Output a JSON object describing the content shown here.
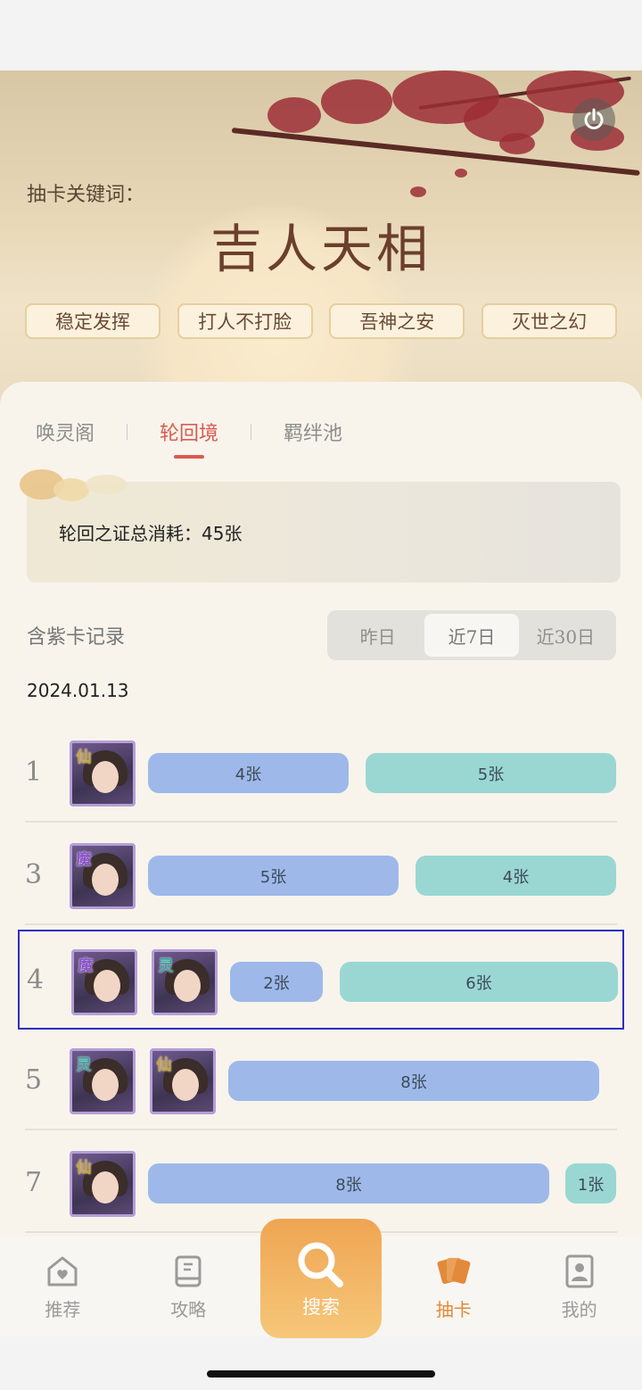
{
  "hero": {
    "keyword_label": "抽卡关键词：",
    "keyword_title": "吉人天相",
    "tags": [
      "稳定发挥",
      "打人不打脸",
      "吾神之安",
      "灭世之幻"
    ],
    "power_icon": "power-icon"
  },
  "tabs": [
    "唤灵阁",
    "轮回境",
    "羁绊池"
  ],
  "active_tab": "轮回境",
  "total": "轮回之证总消耗：45张",
  "records": {
    "title": "含紫卡记录",
    "segments": [
      "昨日",
      "近7日",
      "近30日"
    ],
    "active_segment": "近7日",
    "date": "2024.01.13"
  },
  "rows": [
    {
      "rank": "1",
      "avatars": [
        {
          "badge": "仙",
          "badge_color": "#c9a234"
        }
      ],
      "bars": [
        {
          "label": "4张",
          "color": "blue"
        },
        {
          "label": "5张",
          "color": "teal"
        }
      ]
    },
    {
      "rank": "3",
      "avatars": [
        {
          "badge": "魔",
          "badge_color": "#8a55c6"
        }
      ],
      "bars": [
        {
          "label": "5张",
          "color": "blue"
        },
        {
          "label": "4张",
          "color": "teal"
        }
      ]
    },
    {
      "rank": "4",
      "avatars": [
        {
          "badge": "魔",
          "badge_color": "#8a55c6"
        },
        {
          "badge": "灵",
          "badge_color": "#3aa7a0"
        }
      ],
      "bars": [
        {
          "label": "2张",
          "color": "blue"
        },
        {
          "label": "6张",
          "color": "teal"
        }
      ]
    },
    {
      "rank": "5",
      "avatars": [
        {
          "badge": "灵",
          "badge_color": "#3aa7a0"
        },
        {
          "badge": "仙",
          "badge_color": "#c9a234"
        }
      ],
      "bars": [
        {
          "label": "8张",
          "color": "blue"
        }
      ]
    },
    {
      "rank": "7",
      "avatars": [
        {
          "badge": "仙",
          "badge_color": "#c9a234"
        }
      ],
      "bars": [
        {
          "label": "8张",
          "color": "blue"
        },
        {
          "label": "1张",
          "color": "teal"
        }
      ]
    }
  ],
  "nav": {
    "items": [
      {
        "label": "推荐",
        "icon": "home-heart-icon"
      },
      {
        "label": "攻略",
        "icon": "book-icon"
      },
      {
        "label": "抽卡",
        "icon": "cards-icon"
      },
      {
        "label": "我的",
        "icon": "profile-icon"
      }
    ],
    "search_label": "搜索",
    "search_icon": "search-icon"
  },
  "colors": {
    "accent": "#d95b4f",
    "nav_active": "#e3893a",
    "bar_blue": "#9eb9e9",
    "bar_teal": "#9ad7d3"
  }
}
